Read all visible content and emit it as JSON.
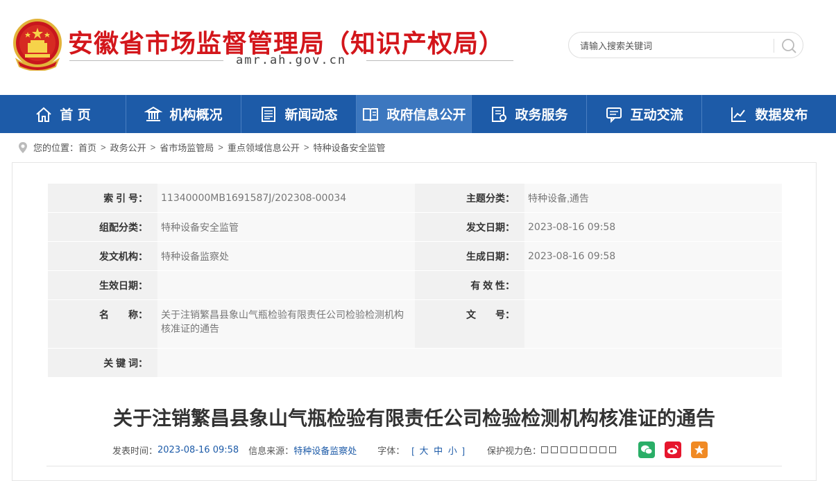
{
  "header": {
    "site_title": "安徽省市场监督管理局（知识产权局）",
    "domain": "amr.ah.gov.cn",
    "search_placeholder": "请输入搜索关键词"
  },
  "nav": {
    "items": [
      {
        "label": "首 页",
        "icon": "home-icon"
      },
      {
        "label": "机构概况",
        "icon": "building-icon"
      },
      {
        "label": "新闻动态",
        "icon": "news-icon"
      },
      {
        "label": "政府信息公开",
        "icon": "book-icon",
        "active": true
      },
      {
        "label": "政务服务",
        "icon": "service-icon"
      },
      {
        "label": "互动交流",
        "icon": "chat-icon"
      },
      {
        "label": "数据发布",
        "icon": "chart-icon"
      }
    ]
  },
  "breadcrumb": {
    "prefix": "您的位置：",
    "items": [
      "首页",
      "政务公开",
      "省市场监管局",
      "重点领域信息公开",
      "特种设备安全监管"
    ]
  },
  "meta": {
    "index_label": "索 引 号：",
    "index_value": "11340000MB1691587J/202308-00034",
    "topic_label": "主题分类：",
    "topic_value": "特种设备,通告",
    "org_cat_label": "组配分类：",
    "org_cat_value": "特种设备安全监管",
    "issue_date_label": "发文日期：",
    "issue_date_value": "2023-08-16 09:58",
    "issuer_label": "发文机构：",
    "issuer_value": "特种设备监察处",
    "created_label": "生成日期：",
    "created_value": "2023-08-16 09:58",
    "effective_label": "生效日期：",
    "effective_value": "",
    "validity_label": "有 效 性：",
    "validity_value": "",
    "name_label": "名　　称：",
    "name_value": "关于注销繁昌县象山气瓶检验有限责任公司检验检测机构核准证的通告",
    "docno_label": "文　　号：",
    "docno_value": "",
    "keywords_label": "关 键 词：",
    "keywords_value": ""
  },
  "article": {
    "title": "关于注销繁昌县象山气瓶检验有限责任公司检验检测机构核准证的通告",
    "publish_time_label": "发表时间：",
    "publish_time": "2023-08-16 09:58",
    "source_label": "信息来源：",
    "source": "特种设备监察处",
    "font_label": "字体：",
    "font_open": "[",
    "font_large": "大",
    "font_medium": "中",
    "font_small": "小",
    "font_close": "]",
    "eye_label": "保护视力色："
  },
  "colors": {
    "brand_red": "#d3161b",
    "nav_blue": "#1d5ba8",
    "wechat": "#2aae67",
    "weibo": "#e6162d",
    "favorite": "#f08a24"
  }
}
